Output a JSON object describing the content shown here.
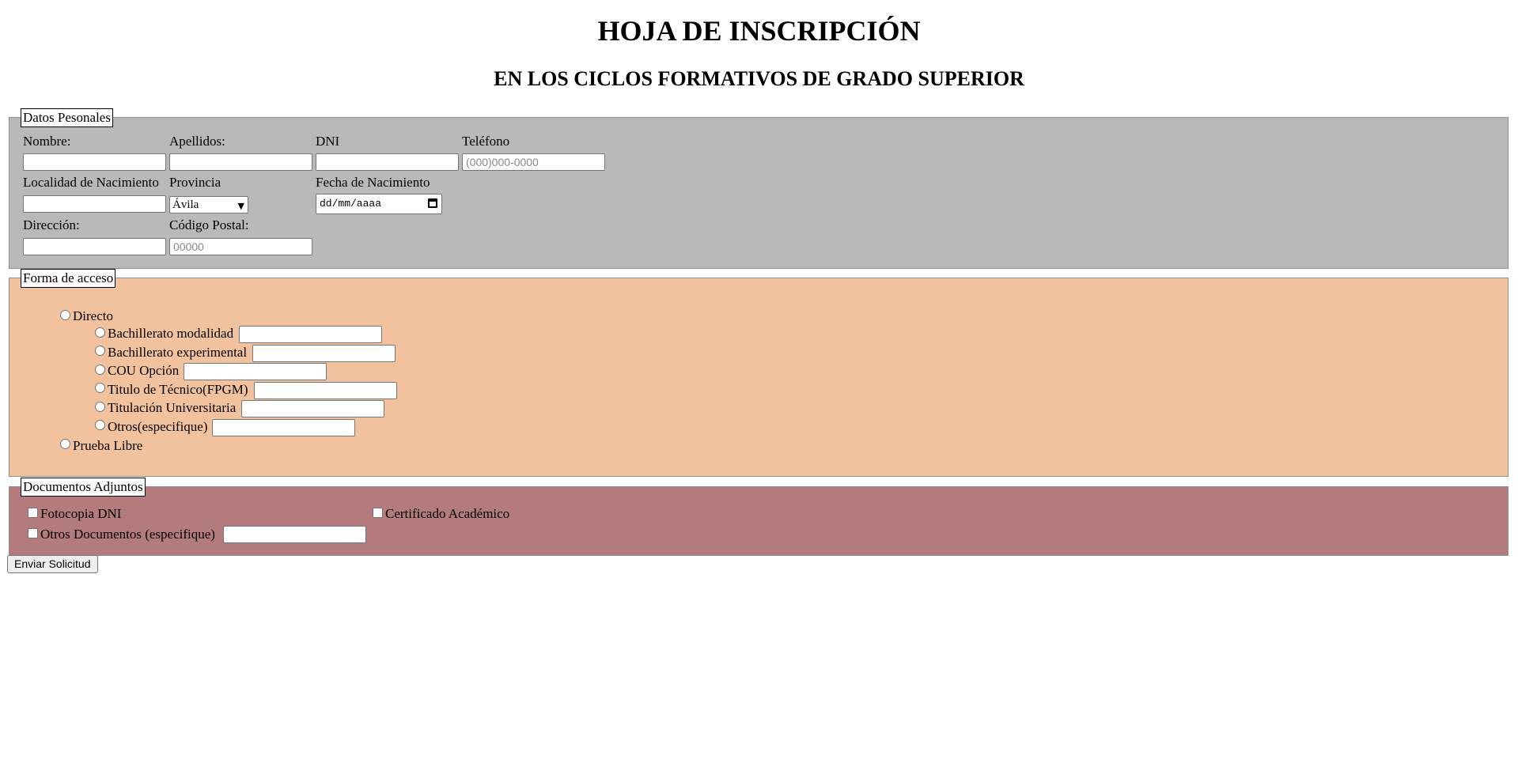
{
  "header": {
    "title": "HOJA DE INSCRIPCIÓN",
    "subtitle": "EN LOS CICLOS FORMATIVOS DE GRADO SUPERIOR"
  },
  "personal": {
    "legend": "Datos Pesonales",
    "nombre_label": "Nombre:",
    "nombre_value": "",
    "apellidos_label": "Apellidos:",
    "apellidos_value": "",
    "dni_label": "DNI",
    "dni_value": "",
    "telefono_label": "Teléfono",
    "telefono_placeholder": "(000)000-0000",
    "localidad_label": "Localidad de Nacimiento",
    "localidad_value": "",
    "provincia_label": "Provincia",
    "provincia_selected": "Ávila",
    "fecha_label": "Fecha de Nacimiento",
    "fecha_placeholder": "dd/mm/aaaa",
    "direccion_label": "Dirección:",
    "direccion_value": "",
    "cp_label": "Código Postal:",
    "cp_placeholder": "00000"
  },
  "acceso": {
    "legend": "Forma de acceso",
    "directo_label": "Directo",
    "options": [
      {
        "label": "Bachillerato modalidad",
        "value": ""
      },
      {
        "label": "Bachillerato experimental",
        "value": ""
      },
      {
        "label": "COU Opción",
        "value": ""
      },
      {
        "label": "Titulo de Técnico(FPGM)",
        "value": ""
      },
      {
        "label": "Titulación Universitaria",
        "value": ""
      },
      {
        "label": "Otros(especifique)",
        "value": ""
      }
    ],
    "prueba_label": "Prueba Libre"
  },
  "documentos": {
    "legend": "Documentos Adjuntos",
    "fotocopia_label": "Fotocopia DNI",
    "certificado_label": "Certificado Académico",
    "otros_label": "Otros Documentos (especifique)",
    "otros_value": ""
  },
  "submit_label": "Enviar Solicitud",
  "icons": {
    "select": "chevron-down-icon",
    "date": "calendar-icon"
  }
}
